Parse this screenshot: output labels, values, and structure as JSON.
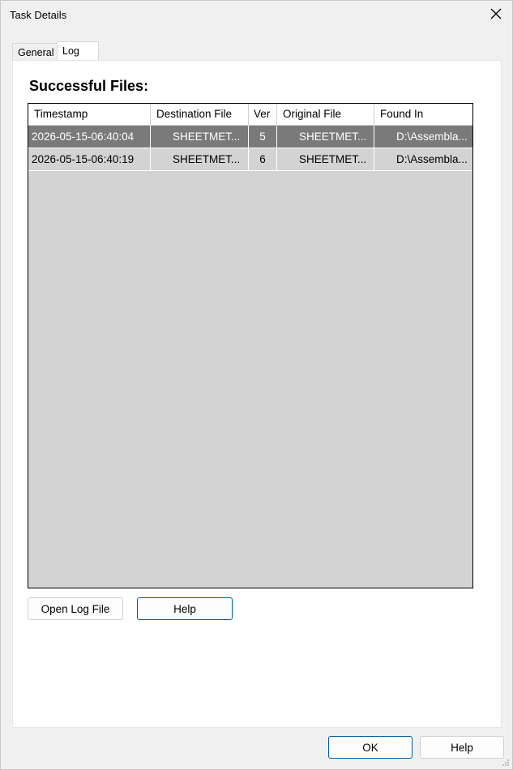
{
  "window": {
    "title": "Task Details"
  },
  "tabs": [
    {
      "label": "General",
      "active": false
    },
    {
      "label": "Log",
      "active": true
    }
  ],
  "log": {
    "section_title": "Successful Files:",
    "columns": [
      "Timestamp",
      "Destination File",
      "Ver",
      "Original File",
      "Found In"
    ],
    "rows": [
      {
        "timestamp": "2026-05-15-06:40:04",
        "destination": "SHEETMET...",
        "ver": "5",
        "original": "SHEETMET...",
        "found_in": "D:\\Assembla...",
        "selected": true
      },
      {
        "timestamp": "2026-05-15-06:40:19",
        "destination": "SHEETMET...",
        "ver": "6",
        "original": "SHEETMET...",
        "found_in": "D:\\Assembla...",
        "selected": false
      }
    ],
    "open_log_label": "Open Log File",
    "help_label": "Help"
  },
  "footer": {
    "ok_label": "OK",
    "help_label": "Help"
  },
  "colors": {
    "selected_row": "#7a7a7a",
    "list_background": "#d3d3d3",
    "accent_border": "#005a9e",
    "dialog_background": "#f0f0f0"
  },
  "icons": {
    "close": "close-icon",
    "resize": "resize-grip-icon"
  }
}
